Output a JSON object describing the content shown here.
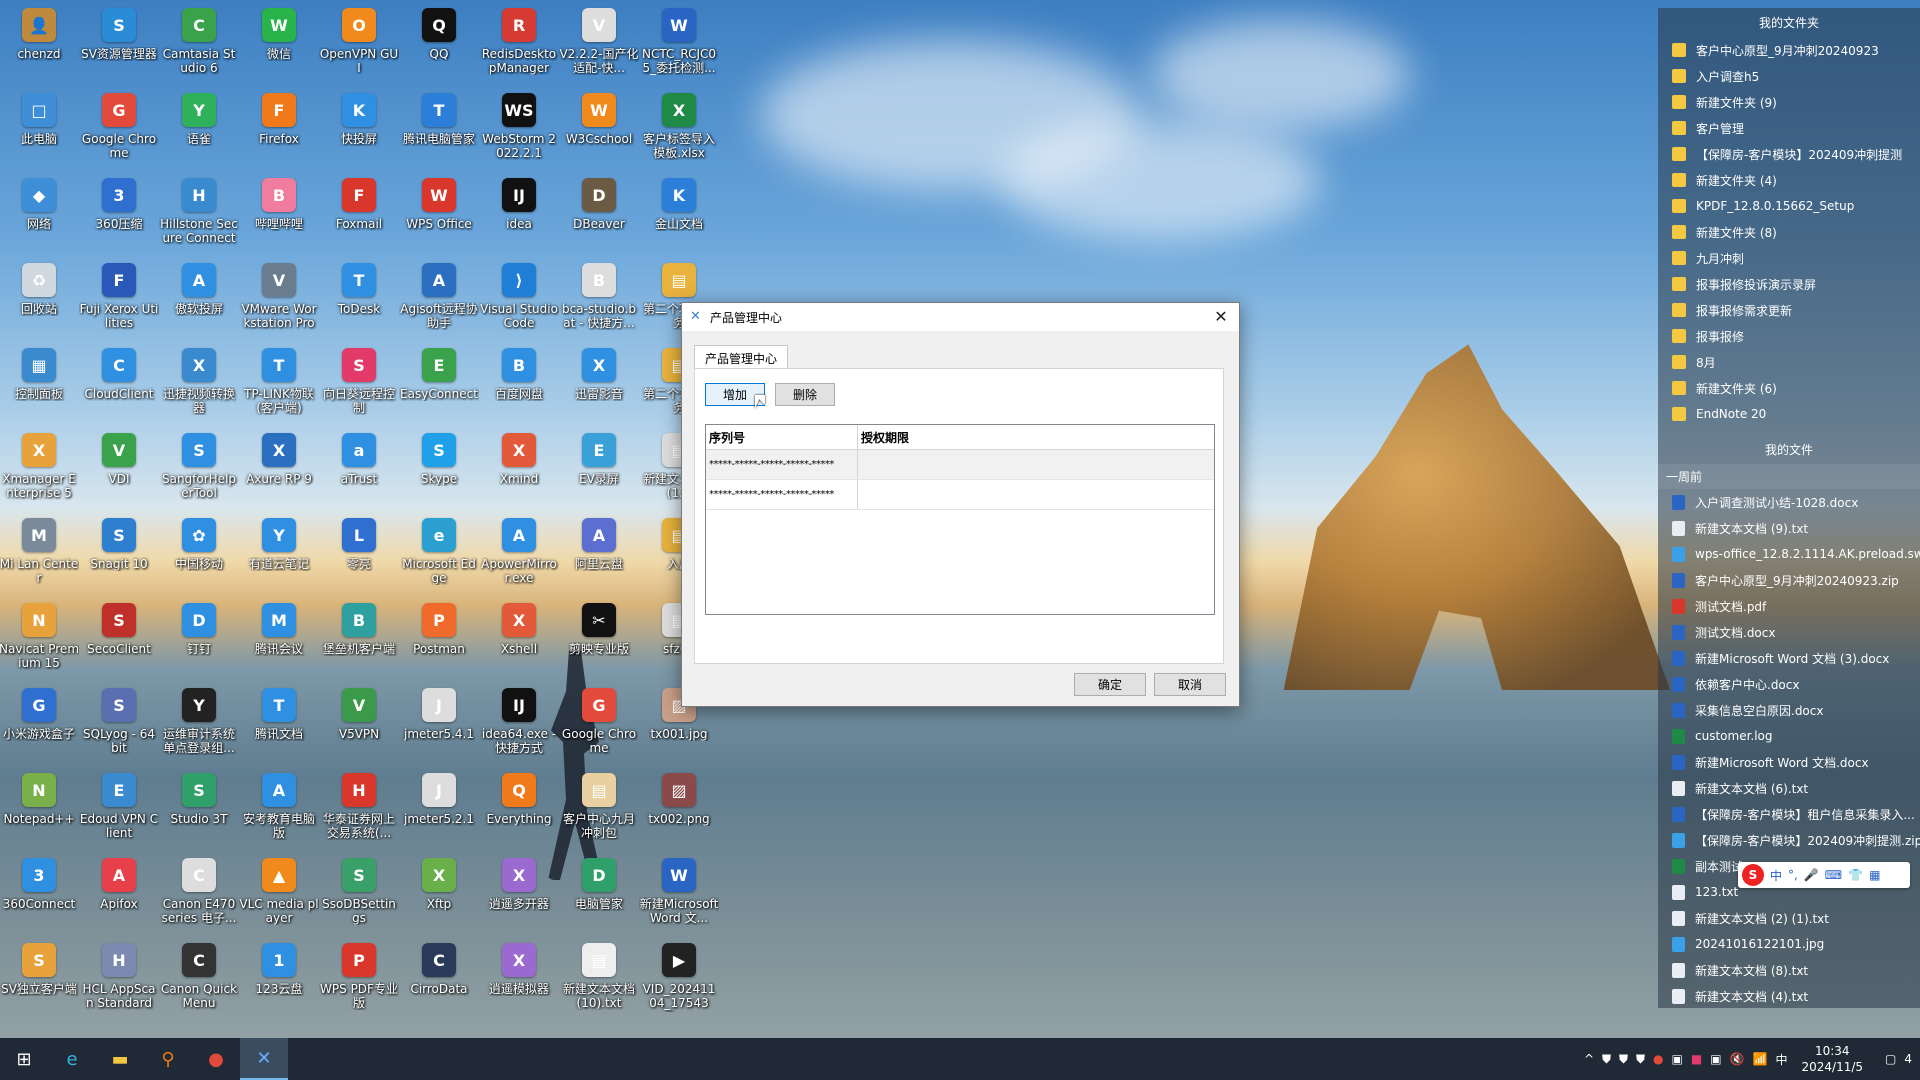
{
  "desktop_icons": [
    {
      "label": "chenzd",
      "color": "#c08a3e",
      "glyph": "👤"
    },
    {
      "label": "SV资源管理器",
      "color": "#2a8bd6",
      "glyph": "S"
    },
    {
      "label": "Camtasia Studio 6",
      "color": "#3aa24a",
      "glyph": "C"
    },
    {
      "label": "微信",
      "color": "#29b34b",
      "glyph": "W"
    },
    {
      "label": "OpenVPN GUI",
      "color": "#f08a1c",
      "glyph": "O"
    },
    {
      "label": "QQ",
      "color": "#111",
      "glyph": "Q"
    },
    {
      "label": "RedisDesktopManager",
      "color": "#d53a33",
      "glyph": "R"
    },
    {
      "label": "V2.2.2-国产化适配-快...",
      "color": "#ddd",
      "glyph": "V"
    },
    {
      "label": "NCTC_RCJC05_委托检测...",
      "color": "#2b65c4",
      "glyph": "W"
    },
    {
      "label": "此电脑",
      "color": "#3f8fd8",
      "glyph": "□"
    },
    {
      "label": "Google Chrome",
      "color": "#e24b3b",
      "glyph": "G"
    },
    {
      "label": "语雀",
      "color": "#2fb05a",
      "glyph": "Y"
    },
    {
      "label": "Firefox",
      "color": "#f07a1a",
      "glyph": "F"
    },
    {
      "label": "快投屏",
      "color": "#2f8fe0",
      "glyph": "K"
    },
    {
      "label": "腾讯电脑管家",
      "color": "#2b7fd9",
      "glyph": "T"
    },
    {
      "label": "WebStorm 2022.2.1",
      "color": "#111",
      "glyph": "WS"
    },
    {
      "label": "W3Cschool",
      "color": "#f08a1c",
      "glyph": "W"
    },
    {
      "label": "客户标签导入模板.xlsx",
      "color": "#1e8a46",
      "glyph": "X"
    },
    {
      "label": "网络",
      "color": "#3f8fd8",
      "glyph": "◆"
    },
    {
      "label": "360压缩",
      "color": "#2f6fd0",
      "glyph": "3"
    },
    {
      "label": "Hillstone Secure Connect",
      "color": "#3a8ad0",
      "glyph": "H"
    },
    {
      "label": "哔哩哔哩",
      "color": "#f07ca0",
      "glyph": "B"
    },
    {
      "label": "Foxmail",
      "color": "#d9362c",
      "glyph": "F"
    },
    {
      "label": "WPS Office",
      "color": "#d9362c",
      "glyph": "W"
    },
    {
      "label": "idea",
      "color": "#111",
      "glyph": "IJ"
    },
    {
      "label": "DBeaver",
      "color": "#6b5a44",
      "glyph": "D"
    },
    {
      "label": "金山文档",
      "color": "#2b7fd9",
      "glyph": "K"
    },
    {
      "label": "回收站",
      "color": "#cfd8df",
      "glyph": "♻"
    },
    {
      "label": "Fuji Xerox Utilities",
      "color": "#2a58b8",
      "glyph": "F"
    },
    {
      "label": "傲软投屏",
      "color": "#2f8fe0",
      "glyph": "A"
    },
    {
      "label": "VMware Workstation Pro",
      "color": "#6a7d8f",
      "glyph": "V"
    },
    {
      "label": "ToDesk",
      "color": "#2f8fe0",
      "glyph": "T"
    },
    {
      "label": "Agisoft远程协助手",
      "color": "#2a6fc0",
      "glyph": "A"
    },
    {
      "label": "Visual Studio Code",
      "color": "#1f7fd6",
      "glyph": "⟩"
    },
    {
      "label": "bca-studio.bat - 快捷方...",
      "color": "#ddd",
      "glyph": "B"
    },
    {
      "label": "第二个项目任务",
      "color": "#e8b23c",
      "glyph": "▤"
    },
    {
      "label": "控制面板",
      "color": "#3a8ad0",
      "glyph": "▦"
    },
    {
      "label": "CloudClient",
      "color": "#2f8fe0",
      "glyph": "C"
    },
    {
      "label": "迅捷视频转换器",
      "color": "#3a8ad0",
      "glyph": "X"
    },
    {
      "label": "TP-LINK物联(客户端)",
      "color": "#2f8fe0",
      "glyph": "T"
    },
    {
      "label": "向日葵远程控制",
      "color": "#e23b6a",
      "glyph": "S"
    },
    {
      "label": "EasyConnect",
      "color": "#3aa24a",
      "glyph": "E"
    },
    {
      "label": "百度网盘",
      "color": "#2f8fe0",
      "glyph": "B"
    },
    {
      "label": "迅雷影音",
      "color": "#2f8fe0",
      "glyph": "X"
    },
    {
      "label": "第二个项目任务",
      "color": "#e8b23c",
      "glyph": "▤"
    },
    {
      "label": "Xmanager Enterprise 5",
      "color": "#e8a23c",
      "glyph": "X"
    },
    {
      "label": "VDI",
      "color": "#3aa24a",
      "glyph": "V"
    },
    {
      "label": "SangforHelperTool",
      "color": "#2f8fe0",
      "glyph": "S"
    },
    {
      "label": "Axure RP 9",
      "color": "#2a6fc0",
      "glyph": "X"
    },
    {
      "label": "aTrust",
      "color": "#2f8fe0",
      "glyph": "a"
    },
    {
      "label": "Skype",
      "color": "#1fa0e8",
      "glyph": "S"
    },
    {
      "label": "Xmind",
      "color": "#e25a3a",
      "glyph": "X"
    },
    {
      "label": "EV录屏",
      "color": "#3aa0d8",
      "glyph": "E"
    },
    {
      "label": "新建文本文档(12)",
      "color": "#ddd",
      "glyph": "▤"
    },
    {
      "label": "Mi Lan Center",
      "color": "#7a8a9a",
      "glyph": "M"
    },
    {
      "label": "Snagit 10",
      "color": "#2f7fd0",
      "glyph": "S"
    },
    {
      "label": "中国移动",
      "color": "#2f8fe0",
      "glyph": "✿"
    },
    {
      "label": "有道云笔记",
      "color": "#2f8fe0",
      "glyph": "Y"
    },
    {
      "label": "零亮",
      "color": "#2f6fd0",
      "glyph": "L"
    },
    {
      "label": "Microsoft Edge",
      "color": "#2a9fd0",
      "glyph": "e"
    },
    {
      "label": "ApowerMirror.exe",
      "color": "#2f8fe0",
      "glyph": "A"
    },
    {
      "label": "阿里云盘",
      "color": "#5a6fd0",
      "glyph": "A"
    },
    {
      "label": "入户",
      "color": "#e8b23c",
      "glyph": "▤"
    },
    {
      "label": "Navicat Premium 15",
      "color": "#e8a23c",
      "glyph": "N"
    },
    {
      "label": "SecoClient",
      "color": "#c0302a",
      "glyph": "S"
    },
    {
      "label": "钉钉",
      "color": "#2f8fe0",
      "glyph": "D"
    },
    {
      "label": "腾讯会议",
      "color": "#2f8fe0",
      "glyph": "M"
    },
    {
      "label": "堡垒机客户端",
      "color": "#2fa0a0",
      "glyph": "B"
    },
    {
      "label": "Postman",
      "color": "#f06a2c",
      "glyph": "P"
    },
    {
      "label": "Xshell",
      "color": "#e25a3a",
      "glyph": "X"
    },
    {
      "label": "剪映专业版",
      "color": "#111",
      "glyph": "✂"
    },
    {
      "label": "sfz00",
      "color": "#ddd",
      "glyph": "▤"
    },
    {
      "label": "小米游戏盒子",
      "color": "#2f6fd0",
      "glyph": "G"
    },
    {
      "label": "SQLyog - 64 bit",
      "color": "#5a6fb0",
      "glyph": "S"
    },
    {
      "label": "运维审计系统单点登录组...",
      "color": "#222",
      "glyph": "Y"
    },
    {
      "label": "腾讯文档",
      "color": "#2f8fe0",
      "glyph": "T"
    },
    {
      "label": "V5VPN",
      "color": "#3a9a4a",
      "glyph": "V"
    },
    {
      "label": "jmeter5.4.1",
      "color": "#ddd",
      "glyph": "J"
    },
    {
      "label": "idea64.exe - 快捷方式",
      "color": "#111",
      "glyph": "IJ"
    },
    {
      "label": "Google Chrome",
      "color": "#e24b3b",
      "glyph": "G"
    },
    {
      "label": "tx001.jpg",
      "color": "#c9a08a",
      "glyph": "▨"
    },
    {
      "label": "Notepad++",
      "color": "#7ab04a",
      "glyph": "N"
    },
    {
      "label": "Edoud VPN Client",
      "color": "#3a8ad0",
      "glyph": "E"
    },
    {
      "label": "Studio 3T",
      "color": "#2fa06a",
      "glyph": "S"
    },
    {
      "label": "安考教育电脑版",
      "color": "#2f8fe0",
      "glyph": "A"
    },
    {
      "label": "华泰证券网上交易系统(...",
      "color": "#d9362c",
      "glyph": "H"
    },
    {
      "label": "jmeter5.2.1",
      "color": "#ddd",
      "glyph": "J"
    },
    {
      "label": "Everything",
      "color": "#f07a1a",
      "glyph": "Q"
    },
    {
      "label": "客户中心九月冲刺包",
      "color": "#e8d0a0",
      "glyph": "▤"
    },
    {
      "label": "tx002.png",
      "color": "#8a4a4a",
      "glyph": "▨"
    },
    {
      "label": "360Connect",
      "color": "#2f8fe0",
      "glyph": "3"
    },
    {
      "label": "Apifox",
      "color": "#e8404a",
      "glyph": "A"
    },
    {
      "label": "Canon E470 series 电子...",
      "color": "#ddd",
      "glyph": "C"
    },
    {
      "label": "VLC media player",
      "color": "#f08a1c",
      "glyph": "▲"
    },
    {
      "label": "SsoDBSettings",
      "color": "#3aa06a",
      "glyph": "S"
    },
    {
      "label": "Xftp",
      "color": "#6ab04a",
      "glyph": "X"
    },
    {
      "label": "逍遥多开器",
      "color": "#9a6ad0",
      "glyph": "X"
    },
    {
      "label": "电脑管家",
      "color": "#2fa06a",
      "glyph": "D"
    },
    {
      "label": "新建Microsoft Word 文...",
      "color": "#2b65c4",
      "glyph": "W"
    },
    {
      "label": "SV独立客户端",
      "color": "#e8a23c",
      "glyph": "S"
    },
    {
      "label": "HCL AppScan Standard",
      "color": "#7a8ab0",
      "glyph": "H"
    },
    {
      "label": "Canon Quick Menu",
      "color": "#333",
      "glyph": "C"
    },
    {
      "label": "123云盘",
      "color": "#2f8fe0",
      "glyph": "1"
    },
    {
      "label": "WPS PDF专业版",
      "color": "#d9362c",
      "glyph": "P"
    },
    {
      "label": "CirroData",
      "color": "#2a3a5a",
      "glyph": "C"
    },
    {
      "label": "逍遥模拟器",
      "color": "#9a6ad0",
      "glyph": "X"
    },
    {
      "label": "新建文本文档(10).txt",
      "color": "#eee",
      "glyph": "▤"
    },
    {
      "label": "VID_20241104_175433....",
      "color": "#222",
      "glyph": "▶"
    }
  ],
  "side_panel": {
    "folders_title": "我的文件夹",
    "folders": [
      "客户中心原型_9月冲刺20240923",
      "入户调查h5",
      "新建文件夹 (9)",
      "客户管理",
      "【保障房-客户模块】202409冲刺提测",
      "新建文件夹 (4)",
      "KPDF_12.8.0.15662_Setup",
      "新建文件夹 (8)",
      "九月冲刺",
      "报事报修投诉演示录屏",
      "报事报修需求更新",
      "报事报修",
      "8月",
      "新建文件夹 (6)",
      "EndNote 20"
    ],
    "files_title": "我的文件",
    "files_sub": "一周前",
    "files": [
      {
        "name": "入户调查测试小结-1028.docx",
        "type": "word"
      },
      {
        "name": "新建文本文档 (9).txt",
        "type": "txt"
      },
      {
        "name": "wps-office_12.8.2.1114.AK.preload.sw...",
        "type": "img"
      },
      {
        "name": "客户中心原型_9月冲刺20240923.zip",
        "type": "word"
      },
      {
        "name": "测试文档.pdf",
        "type": "pdf"
      },
      {
        "name": "测试文档.docx",
        "type": "word"
      },
      {
        "name": "新建Microsoft Word 文档 (3).docx",
        "type": "word"
      },
      {
        "name": "依赖客户中心.docx",
        "type": "word"
      },
      {
        "name": "采集信息空白原因.docx",
        "type": "word"
      },
      {
        "name": "customer.log",
        "type": "xls"
      },
      {
        "name": "新建Microsoft Word 文档.docx",
        "type": "word"
      },
      {
        "name": "新建文本文档 (6).txt",
        "type": "txt"
      },
      {
        "name": "【保障房-客户模块】租户信息采集录入...",
        "type": "word"
      },
      {
        "name": "【保障房-客户模块】202409冲刺提测.zip",
        "type": "img"
      },
      {
        "name": "副本测试",
        "type": "xls"
      },
      {
        "name": "123.txt",
        "type": "txt"
      },
      {
        "name": "新建文本文档 (2) (1).txt",
        "type": "txt"
      },
      {
        "name": "20241016122101.jpg",
        "type": "img"
      },
      {
        "name": "新建文本文档 (8).txt",
        "type": "txt"
      },
      {
        "name": "新建文本文档 (4).txt",
        "type": "txt"
      }
    ]
  },
  "ime_bar": {
    "logo": "S",
    "items": [
      "中",
      "°,",
      "🎤",
      "⌨",
      "👕",
      "▦"
    ]
  },
  "dialog": {
    "title": "产品管理中心",
    "close": "✕",
    "tab": "产品管理中心",
    "add_button": "增加",
    "delete_button": "删除",
    "columns": [
      "序列号",
      "授权期限"
    ],
    "rows": [
      {
        "serial": "*****-*****-*****-*****-*****",
        "term": ""
      },
      {
        "serial": "*****-*****-*****-*****-*****",
        "term": ""
      }
    ],
    "ok_button": "确定",
    "cancel_button": "取消"
  },
  "taskbar": {
    "buttons": [
      {
        "name": "start-button",
        "glyph": "⊞"
      },
      {
        "name": "edge-taskbar-button",
        "glyph": "e"
      },
      {
        "name": "explorer-taskbar-button",
        "glyph": "▬"
      },
      {
        "name": "search-taskbar-button",
        "glyph": "⚲"
      },
      {
        "name": "chrome-taskbar-button",
        "glyph": "●"
      },
      {
        "name": "app-taskbar-button",
        "glyph": "✕"
      }
    ],
    "tray_icons": [
      "^",
      "⛊",
      "⛊",
      "⛊",
      "●",
      "▣",
      "■",
      "▣",
      "🔇",
      "📶",
      "中"
    ],
    "time": "10:34",
    "date": "2024/11/5",
    "notification_count": "4"
  }
}
